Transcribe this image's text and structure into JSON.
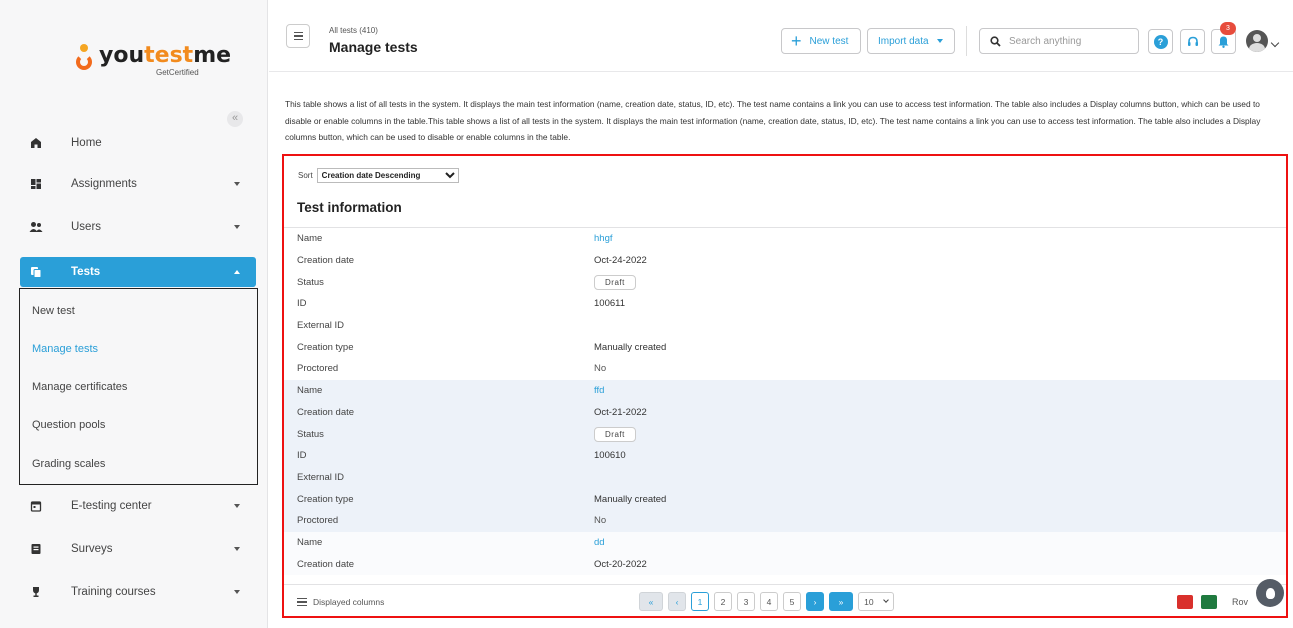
{
  "sidebar": {
    "logo": {
      "prefix": "you",
      "accent": "test",
      "suffix": "me",
      "sub": "GetCertified"
    },
    "collapse": "«",
    "items": [
      {
        "label": "Home",
        "icon": "home-icon"
      },
      {
        "label": "Assignments",
        "icon": "assignments-icon"
      },
      {
        "label": "Users",
        "icon": "users-icon"
      },
      {
        "label": "Tests",
        "icon": "tests-icon"
      },
      {
        "label": "E-testing center",
        "icon": "calendar-icon"
      },
      {
        "label": "Surveys",
        "icon": "survey-icon"
      },
      {
        "label": "Training courses",
        "icon": "trophy-icon"
      }
    ],
    "tests_submenu": [
      {
        "label": "New test"
      },
      {
        "label": "Manage tests"
      },
      {
        "label": "Manage certificates"
      },
      {
        "label": "Question pools"
      },
      {
        "label": "Grading scales"
      }
    ]
  },
  "header": {
    "breadcrumb": "All tests (410)",
    "title": "Manage tests",
    "new_test": "New test",
    "import_data": "Import data",
    "search_placeholder": "Search anything",
    "notification_count": "3"
  },
  "description": "This table shows a list of all tests in the system. It displays the main test information (name, creation date, status, ID, etc). The test name contains a link you can use to access test information. The table also includes a Display columns button, which can be used to disable or enable columns in the table.This table shows a list of all tests in the system. It displays the main test information (name, creation date, status, ID, etc). The test name contains a link you can use to access test information. The table also includes a Display columns button, which can be used to disable or enable columns in the table.",
  "table": {
    "sort_label": "Sort",
    "sort_value": "Creation date Descending",
    "section_title": "Test information",
    "field_labels": {
      "name": "Name",
      "creation_date": "Creation date",
      "status": "Status",
      "id": "ID",
      "external_id": "External ID",
      "creation_type": "Creation type",
      "proctored": "Proctored"
    },
    "records": [
      {
        "name": "hhgf",
        "creation_date": "Oct-24-2022",
        "status": "Draft",
        "id": "100611",
        "external_id": "",
        "creation_type": "Manually created",
        "proctored": "No"
      },
      {
        "name": "ffd",
        "creation_date": "Oct-21-2022",
        "status": "Draft",
        "id": "100610",
        "external_id": "",
        "creation_type": "Manually created",
        "proctored": "No"
      },
      {
        "name": "dd",
        "creation_date": "Oct-20-2022"
      }
    ]
  },
  "footer": {
    "displayed_columns": "Displayed columns",
    "first": "«",
    "prev": "‹",
    "pages": [
      "1",
      "2",
      "3",
      "4",
      "5"
    ],
    "current_page": "1",
    "next": "›",
    "last": "»",
    "per_page": "10",
    "rows_label": "Rov"
  },
  "colors": {
    "accent": "#2a9fd8",
    "highlight_border": "#ee1111",
    "badge": "#e74c3c"
  }
}
